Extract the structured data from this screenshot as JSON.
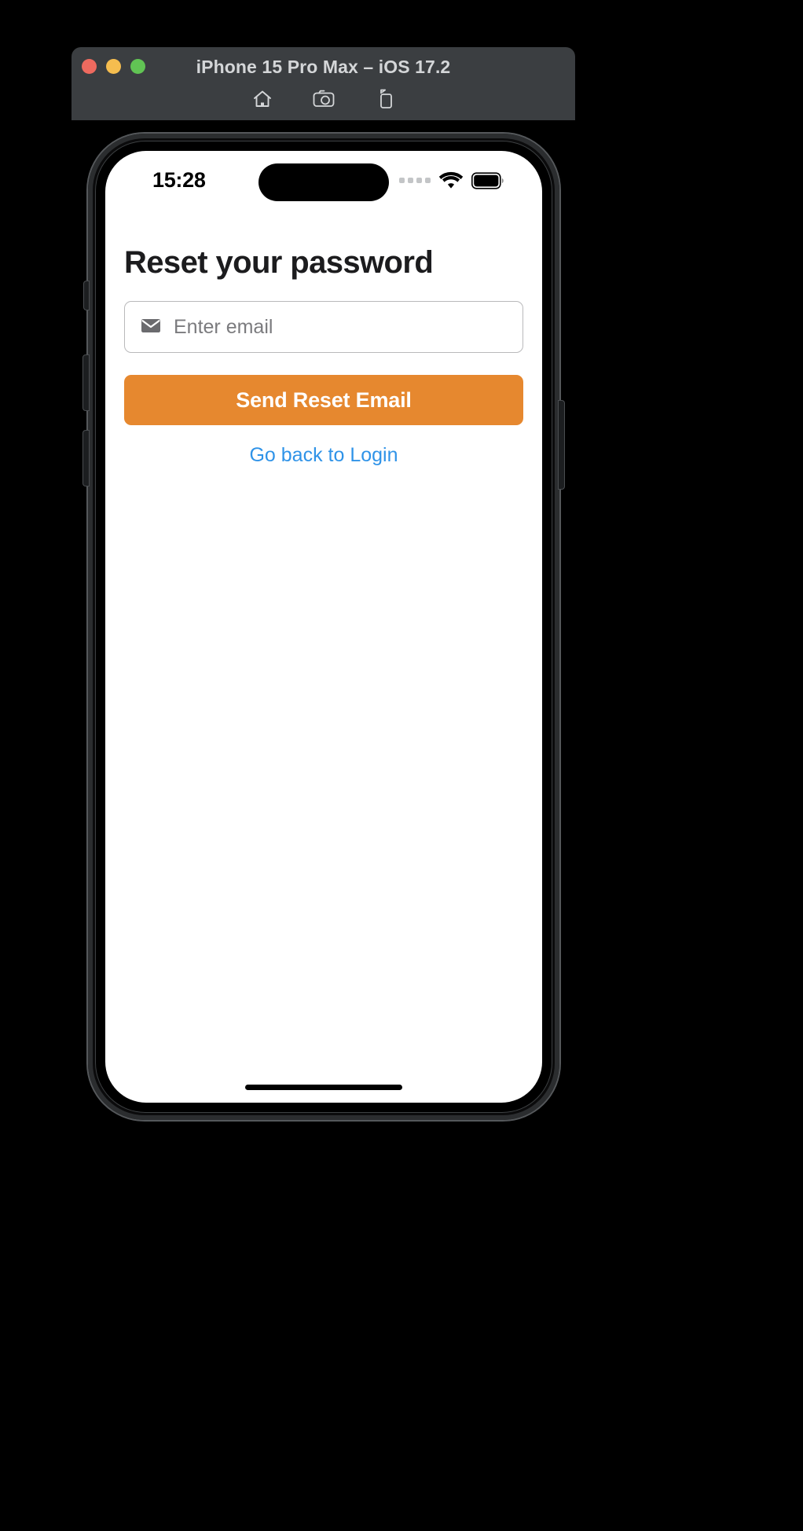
{
  "simulator": {
    "title": "iPhone 15 Pro Max – iOS 17.2",
    "traffic_lights": [
      {
        "name": "close",
        "color": "#ee6a5f"
      },
      {
        "name": "minimize",
        "color": "#f5bd4f"
      },
      {
        "name": "maximize",
        "color": "#61c454"
      }
    ],
    "toolbar": [
      {
        "icon": "home-icon",
        "label": "Home"
      },
      {
        "icon": "screenshot-camera-icon",
        "label": "Screenshot"
      },
      {
        "icon": "rotate-device-icon",
        "label": "Rotate"
      }
    ],
    "chrome_color": "#3b3e41",
    "title_color": "#d4d6d8"
  },
  "status_bar": {
    "time": "15:28",
    "signal_icon": "cellular-signal-icon",
    "wifi_icon": "wifi-icon",
    "battery_icon": "battery-full-icon"
  },
  "screen": {
    "title": "Reset your password",
    "email_field": {
      "icon": "envelope-icon",
      "placeholder": "Enter email",
      "value": ""
    },
    "submit_button": {
      "label": "Send Reset Email",
      "color": "#e6882f",
      "text_color": "#ffffff"
    },
    "back_link": {
      "label": "Go back to Login",
      "color": "#2f93e8"
    },
    "home_indicator": "home-indicator"
  }
}
